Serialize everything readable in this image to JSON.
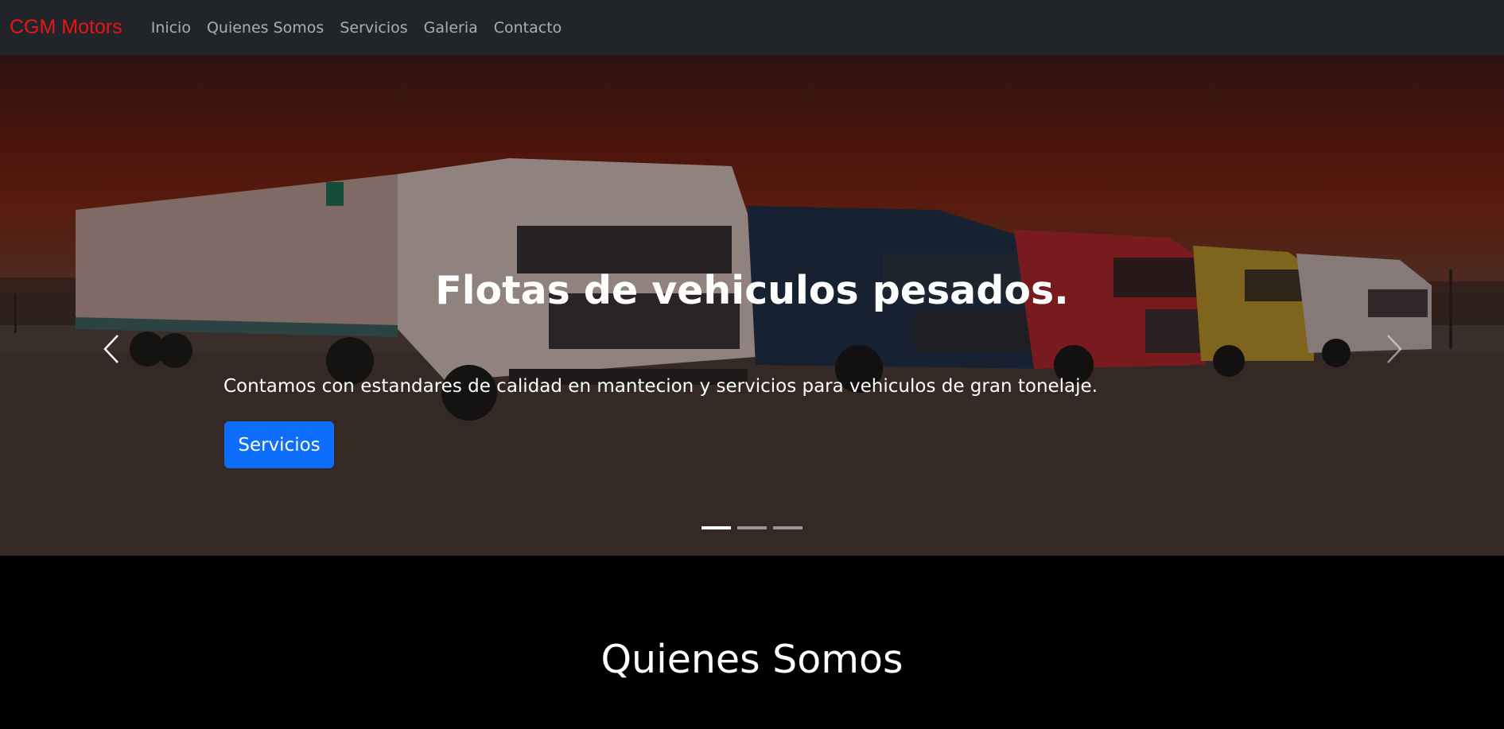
{
  "navbar": {
    "brand": "CGM Motors",
    "brand_color": "#e8141b",
    "background": "#212529",
    "links": [
      {
        "label": "Inicio"
      },
      {
        "label": "Quienes Somos"
      },
      {
        "label": "Servicios"
      },
      {
        "label": "Galeria"
      },
      {
        "label": "Contacto"
      }
    ]
  },
  "hero": {
    "image_description": "Row of heavy trucks parked under a red sunset sky",
    "title": "Flotas de vehiculos pesados.",
    "subtitle": "Contamos con estandares de calidad en mantecion y servicios para vehiculos de gran tonelaje.",
    "button_label": "Servicios",
    "button_color": "#0d6efd",
    "prev_icon": "chevron-left-icon",
    "next_icon": "chevron-right-icon",
    "slides_total": 3,
    "active_slide": 1
  },
  "about": {
    "title": "Quienes Somos"
  }
}
